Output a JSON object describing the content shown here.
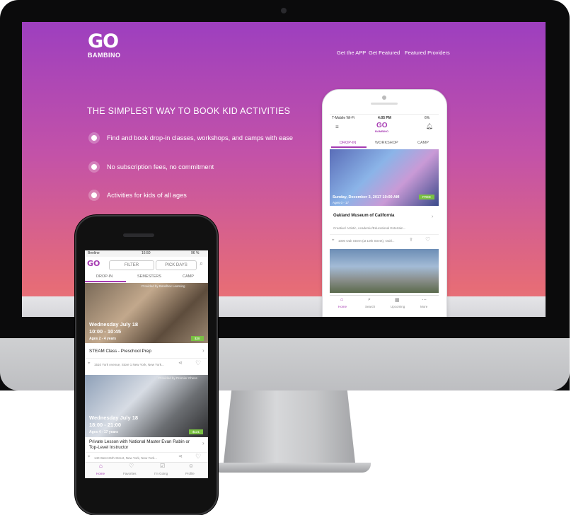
{
  "website": {
    "logo_go": "GO",
    "logo_sub": "BAMBINO",
    "nav": [
      "Get the APP",
      "Get Featured",
      "Featured Providers"
    ],
    "headline": "THE SIMPLEST WAY TO BOOK KID ACTIVITIES",
    "features": [
      "Find and book drop-in classes, workshops, and camps with ease",
      "No subscription fees, no commitment",
      "Activities for kids of all ages"
    ]
  },
  "app_ios": {
    "carrier": "T-Mobile Wi-Fi",
    "time": "4:05 PM",
    "battery": "6%",
    "logo_go": "GO",
    "logo_sub": "BAMBINO",
    "tabs": [
      "DROP-IN",
      "WORKSHOP",
      "CAMP"
    ],
    "card": {
      "date": "Sunday, December 3, 2017 10:00 AM",
      "ages": "Ages 0 - 17",
      "price": "FREE",
      "venue": "Oakland Museum of California",
      "category": "Creative/ Artistic, Academic/Educational Entertain...",
      "address": "1000 Oak Street (at 10th Street), Oakl..."
    },
    "bottom_nav": [
      "Home",
      "Search",
      "Upcoming",
      "More"
    ]
  },
  "app_android": {
    "carrier": "Beeline",
    "time": "16:50",
    "battery": "96 %",
    "logo": "GO",
    "filter": "FILTER",
    "pick_days": "PICK DAYS",
    "tabs": [
      "DROP-IN",
      "SEMESTERS",
      "CAMP"
    ],
    "cards": [
      {
        "provider": "Provided by Bandbox Learning",
        "day": "Wednesday July 18",
        "time": "10:00 - 10:45",
        "ages": "Ages 2 - 4 years",
        "price": "$38",
        "title": "STEAM Class - Preschool Prep",
        "address": "1510 York Avenue, Store 1 New York, New York..."
      },
      {
        "provider": "Provided by Premier Chess",
        "day": "Wednesday July 18",
        "time": "18:00 - 21:00",
        "ages": "Ages 4 - 17 years",
        "price": "$121",
        "title": "Private Lesson with National Master Evan Rabin or Top-Level Instructor",
        "address": "140 West 21th Street, New York, New York..."
      }
    ],
    "bottom_nav": [
      "Home",
      "Favorites",
      "I'm Going",
      "Profile"
    ]
  },
  "colors": {
    "brand_purple": "#a63bb2",
    "price_green": "#7ac143"
  }
}
